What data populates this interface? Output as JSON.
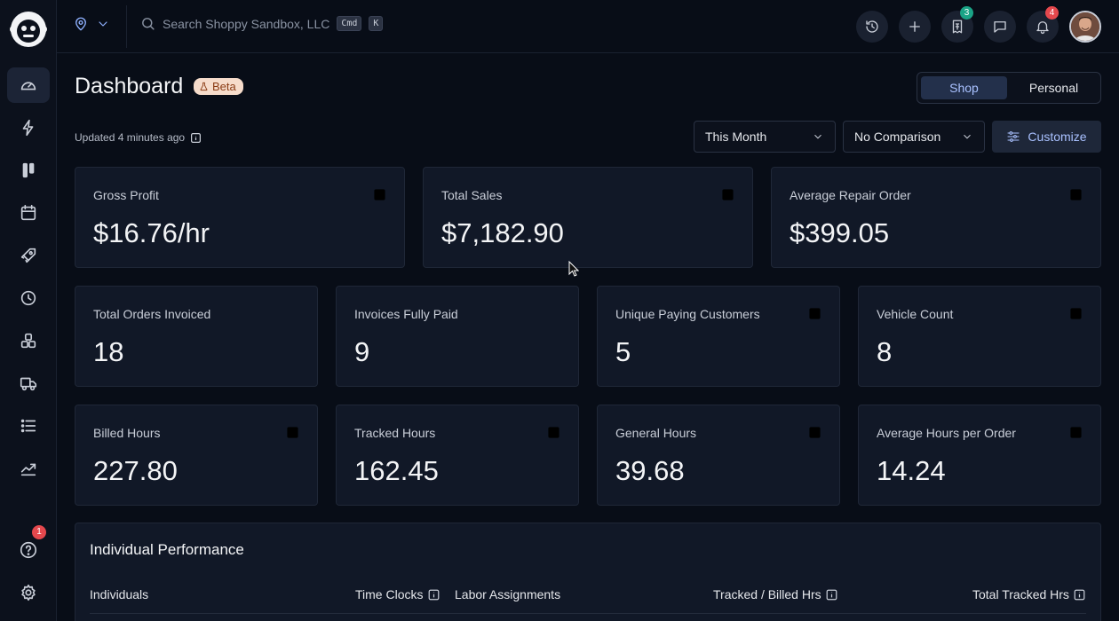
{
  "topbar": {
    "search_placeholder": "Search Shoppy Sandbox, LLC",
    "shortcut_cmd": "Cmd",
    "shortcut_key": "K",
    "tasks_badge": "3",
    "notifications_badge": "4"
  },
  "sidebar": {
    "items": [
      {
        "icon": "dashboard-gauge-icon",
        "active": true
      },
      {
        "icon": "lightning-icon"
      },
      {
        "icon": "board-columns-icon"
      },
      {
        "icon": "calendar-icon"
      },
      {
        "icon": "rocket-icon"
      },
      {
        "icon": "clock-icon"
      },
      {
        "icon": "inventory-icon"
      },
      {
        "icon": "truck-icon"
      },
      {
        "icon": "list-icon"
      },
      {
        "icon": "chart-trend-icon"
      }
    ],
    "help_badge": "1"
  },
  "header": {
    "title": "Dashboard",
    "beta_label": "Beta",
    "updated_text": "Updated 4 minutes ago",
    "view_toggle": [
      "Shop",
      "Personal"
    ],
    "selected_view": "Shop",
    "period": "This Month",
    "comparison": "No Comparison",
    "customize_label": "Customize"
  },
  "metrics_row1": [
    {
      "label": "Gross Profit",
      "value": "$16.76/hr"
    },
    {
      "label": "Total Sales",
      "value": "$7,182.90"
    },
    {
      "label": "Average Repair Order",
      "value": "$399.05"
    }
  ],
  "metrics_row2": [
    {
      "label": "Total Orders Invoiced",
      "value": "18"
    },
    {
      "label": "Invoices Fully Paid",
      "value": "9"
    },
    {
      "label": "Unique Paying Customers",
      "value": "5"
    },
    {
      "label": "Vehicle Count",
      "value": "8"
    }
  ],
  "metrics_row3": [
    {
      "label": "Billed Hours",
      "value": "227.80"
    },
    {
      "label": "Tracked Hours",
      "value": "162.45"
    },
    {
      "label": "General Hours",
      "value": "39.68"
    },
    {
      "label": "Average Hours per Order",
      "value": "14.24"
    }
  ],
  "performance": {
    "title": "Individual Performance",
    "columns": [
      "Individuals",
      "Time Clocks",
      "Labor Assignments",
      "Tracked / Billed Hrs",
      "Total Tracked Hrs"
    ]
  },
  "colors": {
    "background": "#080d17",
    "card": "#111827",
    "accent": "#a9c1ff",
    "badge_red": "#e5484d",
    "badge_green": "#1aa386"
  }
}
